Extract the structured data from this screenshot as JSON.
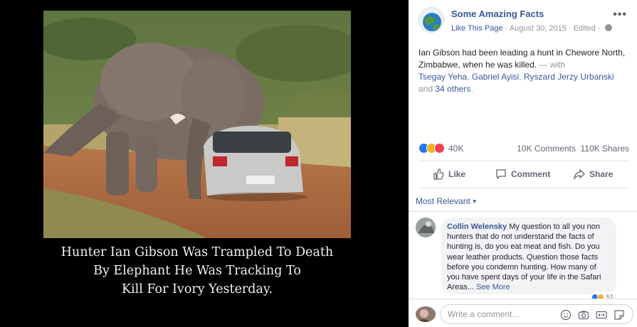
{
  "media": {
    "caption_lines": [
      "Hunter Ian Gibson Was Trampled To Death",
      "By Elephant He Was Tracking To",
      "Kill For Ivory Yesterday."
    ]
  },
  "post": {
    "page_name": "Some Amazing Facts",
    "like_this_page": "Like This Page",
    "date": "August 30, 2015",
    "edited": "Edited",
    "text": "Ian Gibson had been leading a hunt in Chewore North, Zimbabwe, when he was killed.",
    "with_prefix": " — with",
    "tagged": [
      "Tsegay Yeha",
      "Gabriel Ayisi",
      "Ryszard Jerzy Urbanski"
    ],
    "and_word": "and",
    "others": "34 others"
  },
  "stats": {
    "reactions_count": "40K",
    "comments": "10K Comments",
    "shares": "110K Shares",
    "reaction_colors": {
      "like": "#2078f4",
      "haha": "#f7b125",
      "love": "#f33e58"
    }
  },
  "actions": {
    "like": "Like",
    "comment": "Comment",
    "share": "Share"
  },
  "comments": {
    "sort_label": "Most Relevant",
    "items": [
      {
        "author": "Collin Welensky",
        "text": "My question to all you non hunters that do not understand the facts of hunting is, do you eat meat and fish. Do you wear leather products. Question those facts before you condemn hunting. How many of you have spent days of your life in the Safari Areas...",
        "see_more": "See More",
        "reaction_count": "51"
      }
    ]
  },
  "composer": {
    "placeholder": "Write a comment...",
    "icons": [
      "smiley-icon",
      "camera-icon",
      "gif-icon",
      "sticker-icon"
    ]
  },
  "colors": {
    "link": "#385898",
    "muted": "#90949c",
    "text": "#1d2129",
    "divider": "#dadde1"
  }
}
